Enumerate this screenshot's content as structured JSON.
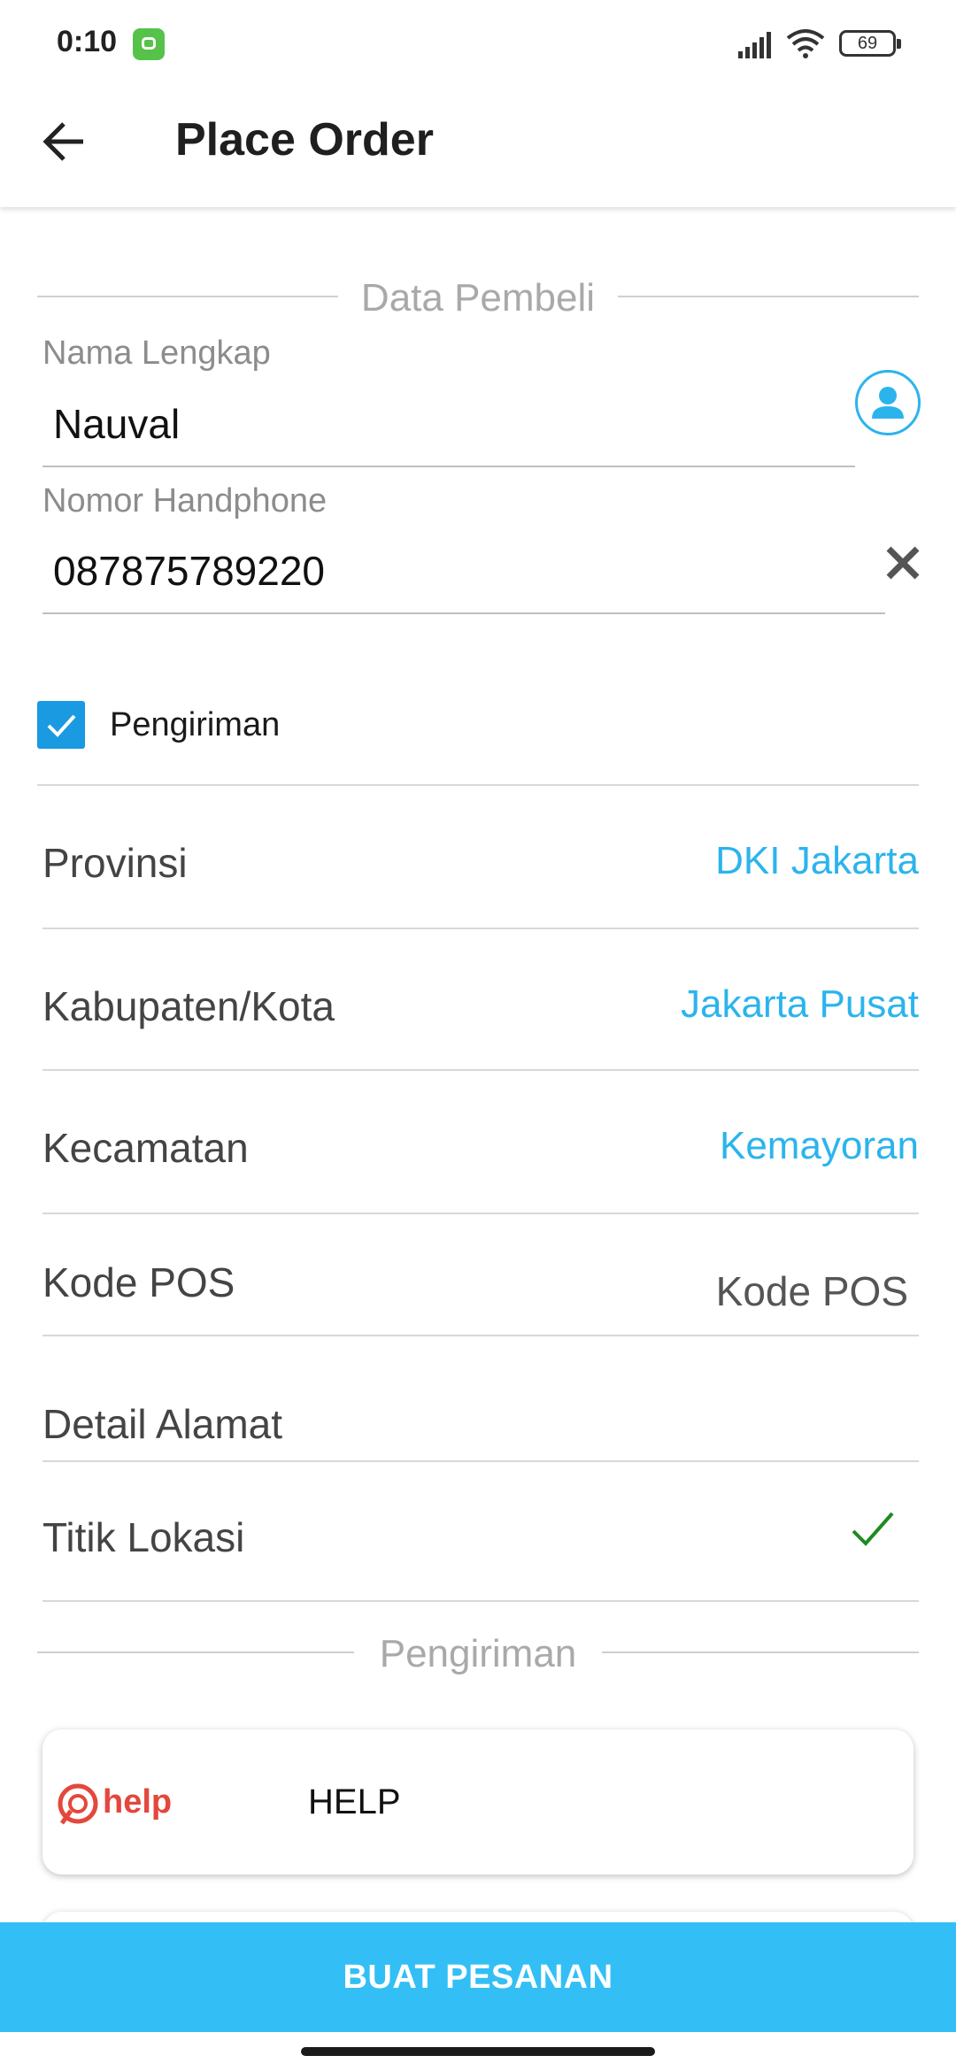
{
  "status_bar": {
    "time": "0:10",
    "battery": "69"
  },
  "app_bar": {
    "title": "Place Order"
  },
  "buyer_section": {
    "title": "Data Pembeli",
    "name_label": "Nama Lengkap",
    "name_value": "Nauval",
    "phone_label": "Nomor Handphone",
    "phone_value": "087875789220"
  },
  "shipping_checkbox": {
    "label": "Pengiriman",
    "checked": true
  },
  "address": {
    "province_label": "Provinsi",
    "province_value": "DKI Jakarta",
    "city_label": "Kabupaten/Kota",
    "city_value": "Jakarta Pusat",
    "district_label": "Kecamatan",
    "district_value": "Kemayoran",
    "postal_label": "Kode POS",
    "postal_placeholder": "Kode POS",
    "detail_label": "Detail Alamat",
    "location_label": "Titik Lokasi"
  },
  "shipping_section": {
    "title": "Pengiriman"
  },
  "courier": {
    "logo_text": "help",
    "name": "HELP"
  },
  "submit": {
    "label": "BUAT PESANAN"
  },
  "colors": {
    "accent": "#2bb4ec",
    "button": "#33bff5",
    "check": "#1a9ae0",
    "help_logo": "#e4473c"
  }
}
